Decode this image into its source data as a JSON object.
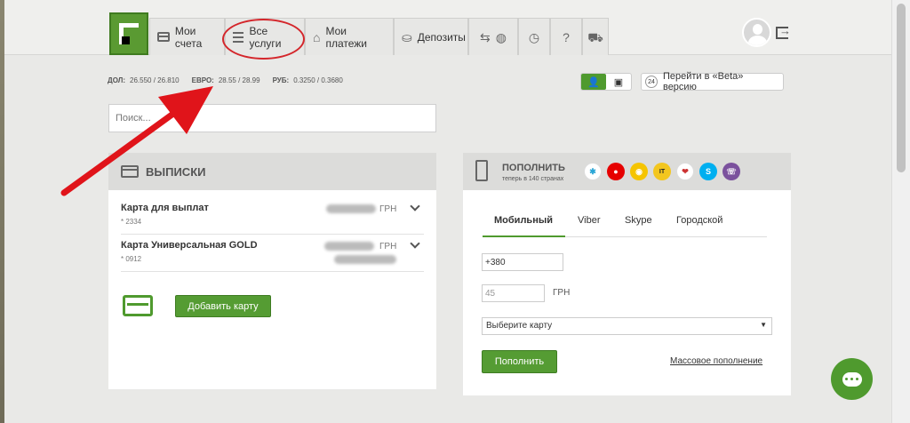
{
  "tabs": [
    {
      "label": "Мои счета"
    },
    {
      "label": "Все услуги"
    },
    {
      "label": "Мои платежи"
    },
    {
      "label": "Депозиты"
    }
  ],
  "rates": [
    {
      "code": "ДОЛ:",
      "value": "26.550 / 26.810"
    },
    {
      "code": "ЕВРО:",
      "value": "28.55 / 28.99"
    },
    {
      "code": "РУБ:",
      "value": "0.3250 / 0.3680"
    }
  ],
  "beta": {
    "badge": "24",
    "label": "Перейти в «Beta» версию"
  },
  "search": {
    "placeholder": "Поиск..."
  },
  "statements": {
    "title": "ВЫПИСКИ",
    "cards": [
      {
        "name": "Карта для выплат",
        "number": "* 2334",
        "currency": "ГРН"
      },
      {
        "name": "Карта Универсальная GOLD",
        "number": "* 0912",
        "currency": "ГРН"
      }
    ],
    "add_card_label": "Добавить карту"
  },
  "topup": {
    "title": "ПОПОЛНИТЬ",
    "subtitle": "теперь в 140 странах",
    "tabs": [
      "Мобильный",
      "Viber",
      "Skype",
      "Городской"
    ],
    "phone_value": "+380",
    "amount_placeholder": "45",
    "amount_currency": "ГРН",
    "card_select": "Выберите карту",
    "submit_label": "Пополнить",
    "bulk_link": "Массовое пополнение"
  },
  "colors": {
    "brand_green": "#4f9a2e",
    "highlight_red": "#d4262b"
  }
}
